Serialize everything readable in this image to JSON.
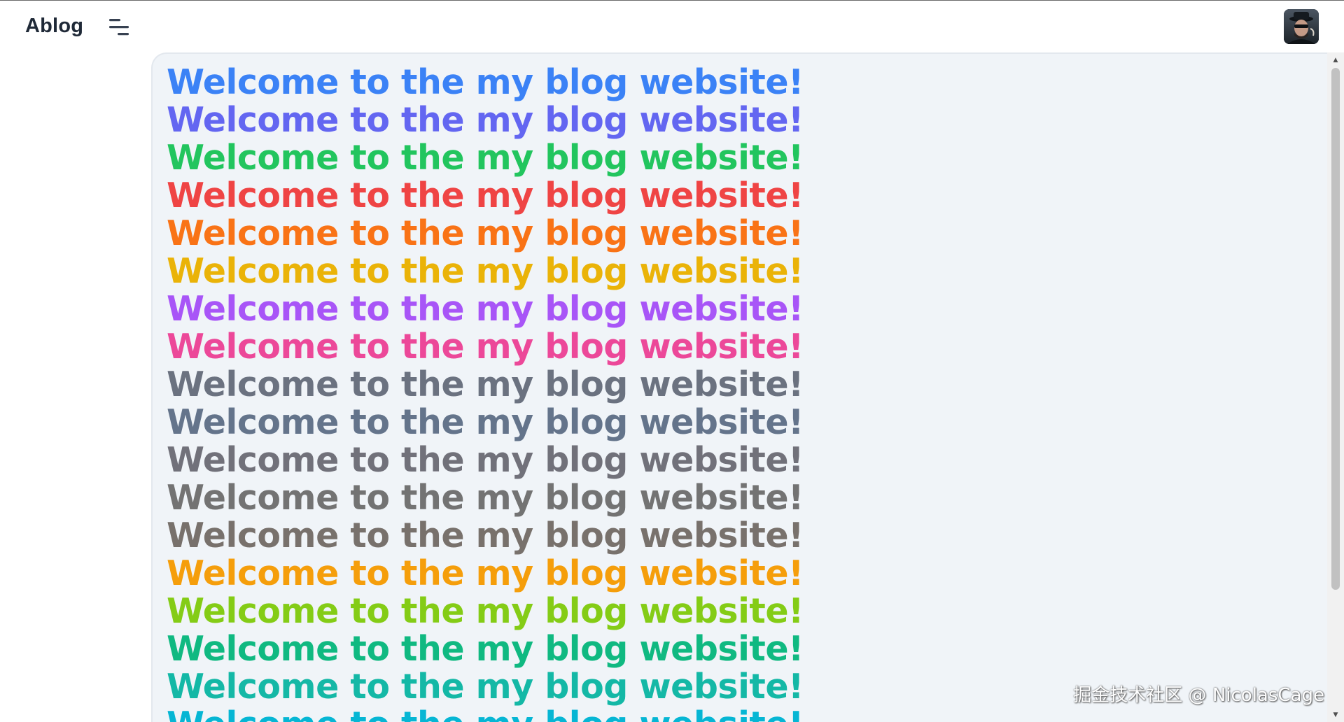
{
  "app": {
    "logo": "Ablog",
    "menu_icon": "menu-fold-icon",
    "avatar_icon": "user-avatar-icon"
  },
  "content": {
    "lines": [
      {
        "text": "Welcome to the my blog website!",
        "color": "#3b82f6"
      },
      {
        "text": "Welcome to the my blog website!",
        "color": "#6366f1"
      },
      {
        "text": "Welcome to the my blog website!",
        "color": "#22c55e"
      },
      {
        "text": "Welcome to the my blog website!",
        "color": "#ef4444"
      },
      {
        "text": "Welcome to the my blog website!",
        "color": "#f97316"
      },
      {
        "text": "Welcome to the my blog website!",
        "color": "#eab308"
      },
      {
        "text": "Welcome to the my blog website!",
        "color": "#a855f7"
      },
      {
        "text": "Welcome to the my blog website!",
        "color": "#ec4899"
      },
      {
        "text": "Welcome to the my blog website!",
        "color": "#6b7280"
      },
      {
        "text": "Welcome to the my blog website!",
        "color": "#64748b"
      },
      {
        "text": "Welcome to the my blog website!",
        "color": "#71717a"
      },
      {
        "text": "Welcome to the my blog website!",
        "color": "#737373"
      },
      {
        "text": "Welcome to the my blog website!",
        "color": "#78716c"
      },
      {
        "text": "Welcome to the my blog website!",
        "color": "#f59e0b"
      },
      {
        "text": "Welcome to the my blog website!",
        "color": "#84cc16"
      },
      {
        "text": "Welcome to the my blog website!",
        "color": "#10b981"
      },
      {
        "text": "Welcome to the my blog website!",
        "color": "#14b8a6"
      },
      {
        "text": "Welcome to the my blog website!",
        "color": "#06b6d4"
      }
    ]
  },
  "watermark": "掘金技术社区 @ NicolasCage"
}
